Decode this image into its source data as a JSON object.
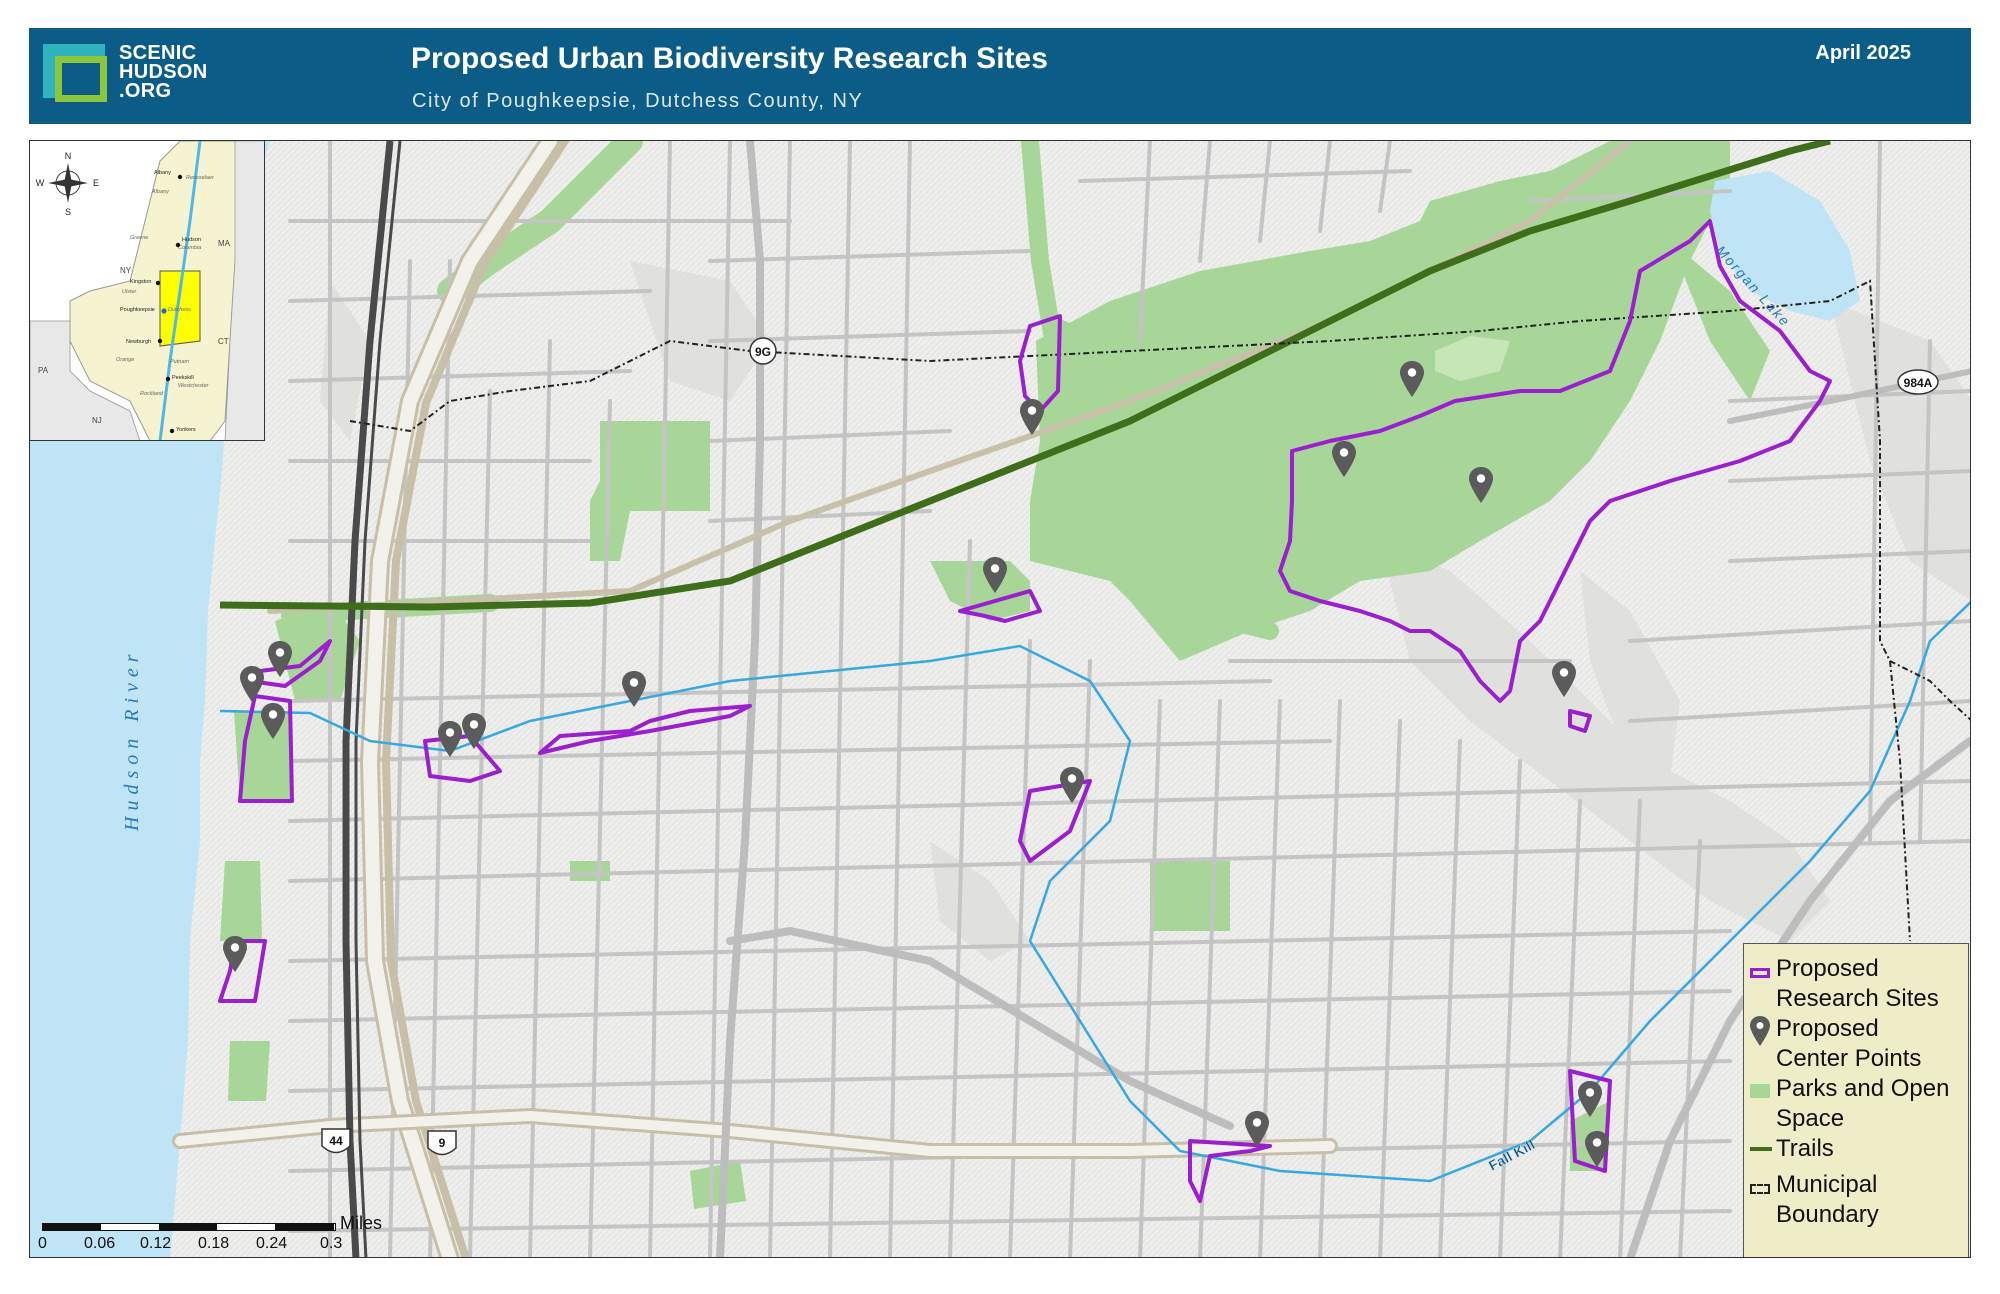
{
  "header": {
    "logo_lines": [
      "SCENIC",
      "HUDSON",
      ".ORG"
    ],
    "title": "Proposed Urban Biodiversity Research Sites",
    "subtitle": "City of Poughkeepsie, Dutchess County, NY",
    "date": "April 2025"
  },
  "colors": {
    "header_bg": "#0b5c86",
    "river": "#bfe4f6",
    "park": "#a8d698",
    "research_site_outline": "#9b1ecf",
    "trail": "#3f6e1a",
    "stream": "#36a9e1",
    "legend_bg": "#efecc8",
    "marker": "#5b5b5b"
  },
  "map": {
    "river_label": "Hudson River",
    "lake_label": "Morgan Lake",
    "creek_label": "Fall Kill",
    "route_shields": [
      "9G",
      "984A",
      "44",
      "9"
    ]
  },
  "inset": {
    "compass": [
      "N",
      "S",
      "E",
      "W"
    ],
    "state_labels": [
      "NY",
      "MA",
      "CT",
      "PA",
      "NJ"
    ],
    "county_labels": [
      "Albany",
      "Rensselaer",
      "Greene",
      "Columbia",
      "Ulster",
      "Dutchess",
      "Orange",
      "Putnam",
      "Rockland",
      "Westchester"
    ],
    "city_labels": [
      "Albany",
      "Hudson",
      "Kingston",
      "Poughkeepsie",
      "Newburgh",
      "Peekskill",
      "Yonkers"
    ]
  },
  "legend": {
    "items": [
      {
        "symbol": "research-site",
        "label_lines": [
          "Proposed",
          "Research Sites"
        ]
      },
      {
        "symbol": "center-point",
        "label_lines": [
          "Proposed",
          "Center Points"
        ]
      },
      {
        "symbol": "park",
        "label_lines": [
          "Parks and Open",
          "Space"
        ]
      },
      {
        "symbol": "trail",
        "label_lines": [
          "Trails"
        ]
      },
      {
        "symbol": "municipal-boundary",
        "label_lines": [
          "Municipal",
          "Boundary"
        ]
      }
    ]
  },
  "scale": {
    "unit": "Miles",
    "ticks": [
      "0",
      "0.06",
      "0.12",
      "0.18",
      "0.24",
      "0.3"
    ]
  }
}
